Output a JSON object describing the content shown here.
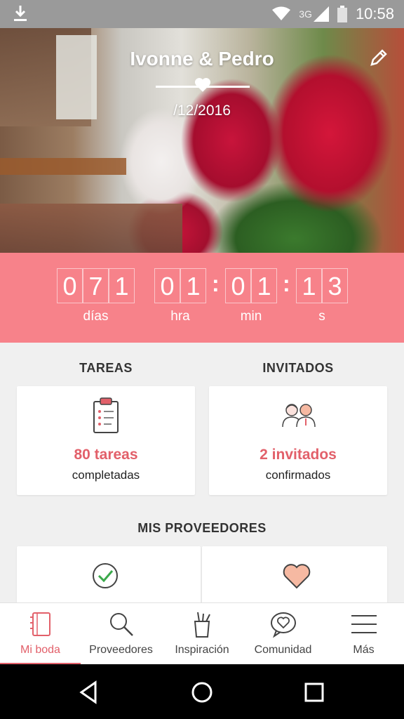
{
  "status_bar": {
    "network": "3G",
    "time": "10:58"
  },
  "hero": {
    "couple": "Ivonne & Pedro",
    "date": "/12/2016"
  },
  "countdown": {
    "days_digits": [
      "0",
      "7",
      "1"
    ],
    "hours_digits": [
      "0",
      "1"
    ],
    "minutes_digits": [
      "0",
      "1"
    ],
    "seconds_digits": [
      "1",
      "3"
    ],
    "labels": {
      "days": "días",
      "hours": "hra",
      "minutes": "min",
      "seconds": "s"
    }
  },
  "tareas": {
    "title": "TAREAS",
    "count": "80 tareas",
    "sub": "completadas"
  },
  "invitados": {
    "title": "INVITADOS",
    "count": "2 invitados",
    "sub": "confirmados"
  },
  "proveedores": {
    "title": "MIS PROVEEDORES"
  },
  "bottom_nav": {
    "items": [
      {
        "label": "Mi boda",
        "icon": "notebook-icon",
        "active": true
      },
      {
        "label": "Proveedores",
        "icon": "search-icon",
        "active": false
      },
      {
        "label": "Inspiración",
        "icon": "pencil-cup-icon",
        "active": false
      },
      {
        "label": "Comunidad",
        "icon": "chat-heart-icon",
        "active": false
      },
      {
        "label": "Más",
        "icon": "menu-icon",
        "active": false
      }
    ]
  },
  "colors": {
    "accent": "#e2606a",
    "countdown_bg": "#f7828a",
    "status_bar": "#9a9a9a"
  }
}
